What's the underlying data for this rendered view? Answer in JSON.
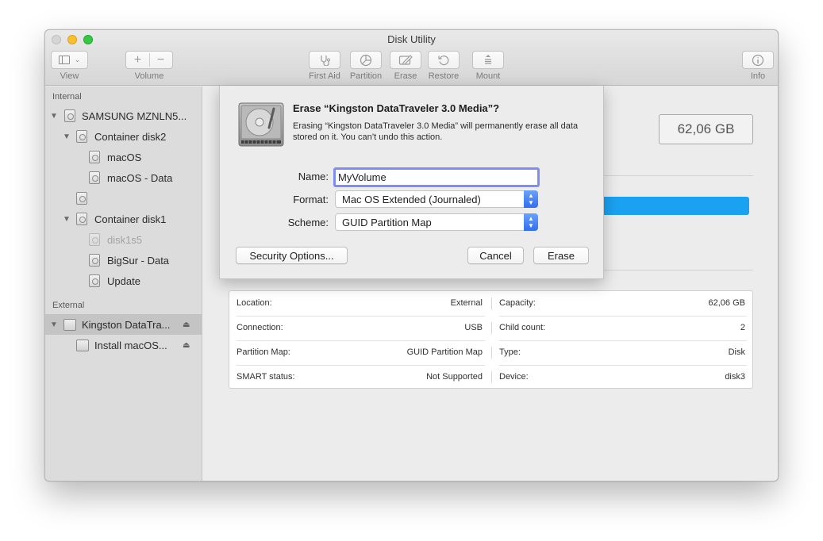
{
  "window": {
    "title": "Disk Utility"
  },
  "toolbar": {
    "view_label": "View",
    "volume_label": "Volume",
    "first_aid_label": "First Aid",
    "partition_label": "Partition",
    "erase_label": "Erase",
    "restore_label": "Restore",
    "mount_label": "Mount",
    "info_label": "Info",
    "volume_add_glyph": "+",
    "volume_remove_glyph": "−"
  },
  "sidebar": {
    "internal_header": "Internal",
    "external_header": "External",
    "internal_items": [
      {
        "label": "SAMSUNG MZNLN5...",
        "level": 0,
        "expanded": true,
        "icon": "internal-disk-icon"
      },
      {
        "label": "Container disk2",
        "level": 1,
        "expanded": true,
        "icon": "container-icon"
      },
      {
        "label": "macOS",
        "level": 2,
        "icon": "volume-icon"
      },
      {
        "label": "macOS - Data",
        "level": 2,
        "icon": "volume-icon"
      },
      {
        "label": "",
        "level": 1,
        "icon": "volume-icon"
      },
      {
        "label": "Container disk1",
        "level": 1,
        "expanded": true,
        "icon": "container-icon"
      },
      {
        "label": "disk1s5",
        "level": 2,
        "dimmed": true,
        "icon": "volume-icon"
      },
      {
        "label": "BigSur - Data",
        "level": 2,
        "icon": "volume-icon"
      },
      {
        "label": "Update",
        "level": 2,
        "icon": "volume-icon"
      }
    ],
    "external_items": [
      {
        "label": "Kingston DataTra...",
        "level": 0,
        "expanded": true,
        "selected": true,
        "eject": true,
        "icon": "external-disk-icon"
      },
      {
        "label": "Install macOS...",
        "level": 1,
        "eject": true,
        "icon": "external-volume-icon"
      }
    ]
  },
  "main": {
    "capacity_display": "62,06 GB",
    "usage_color": "#1ba1f2",
    "info": [
      {
        "left_label": "Location:",
        "left_value": "External",
        "right_label": "Capacity:",
        "right_value": "62,06 GB"
      },
      {
        "left_label": "Connection:",
        "left_value": "USB",
        "right_label": "Child count:",
        "right_value": "2"
      },
      {
        "left_label": "Partition Map:",
        "left_value": "GUID Partition Map",
        "right_label": "Type:",
        "right_value": "Disk"
      },
      {
        "left_label": "SMART status:",
        "left_value": "Not Supported",
        "right_label": "Device:",
        "right_value": "disk3"
      }
    ]
  },
  "erase_sheet": {
    "title": "Erase “Kingston DataTraveler 3.0 Media”?",
    "message": "Erasing “Kingston DataTraveler 3.0 Media” will permanently erase all data stored on it. You can’t undo this action.",
    "name_label": "Name:",
    "name_value": "MyVolume",
    "format_label": "Format:",
    "format_value": "Mac OS Extended (Journaled)",
    "scheme_label": "Scheme:",
    "scheme_value": "GUID Partition Map",
    "security_button": "Security Options...",
    "cancel_button": "Cancel",
    "erase_button": "Erase",
    "accent_color": "#2f6ef0"
  }
}
